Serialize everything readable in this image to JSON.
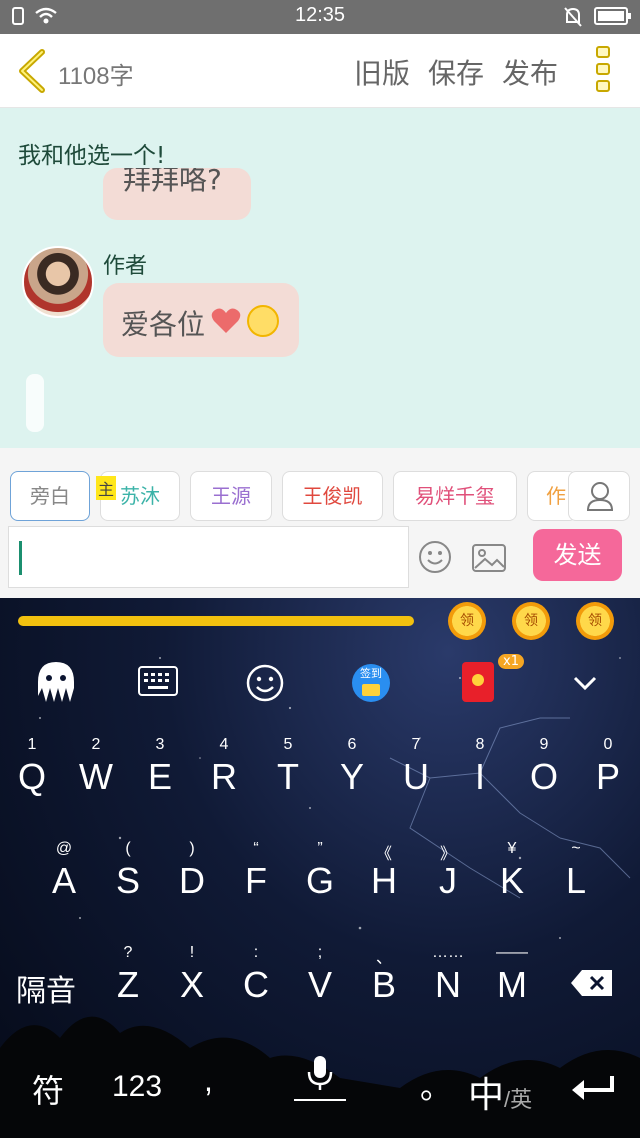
{
  "status": {
    "time": "12:35"
  },
  "header": {
    "word_count": "1108字",
    "old_version": "旧版",
    "save": "保存",
    "publish": "发布"
  },
  "chat": {
    "title": "我和他选一个!",
    "prev_bubble": "拜拜咯?",
    "author_label": "作者",
    "message_text": "爱各位"
  },
  "roles": {
    "items": [
      "旁白",
      "苏沐",
      "王源",
      "王俊凯",
      "易烊千玺",
      "作"
    ],
    "main_badge": "主",
    "colors": [
      "#888888",
      "#3bb3a8",
      "#9a6fd0",
      "#e0483e",
      "#e0507a",
      "#f0a040"
    ]
  },
  "input": {
    "value": "",
    "send_label": "发送"
  },
  "keyboard": {
    "coins": [
      "领",
      "领",
      "领"
    ],
    "signin_label": "签到",
    "redpacket_count": "x1",
    "row1": [
      {
        "n": "1",
        "l": "Q"
      },
      {
        "n": "2",
        "l": "W"
      },
      {
        "n": "3",
        "l": "E"
      },
      {
        "n": "4",
        "l": "R"
      },
      {
        "n": "5",
        "l": "T"
      },
      {
        "n": "6",
        "l": "Y"
      },
      {
        "n": "7",
        "l": "U"
      },
      {
        "n": "8",
        "l": "I"
      },
      {
        "n": "9",
        "l": "O"
      },
      {
        "n": "0",
        "l": "P"
      }
    ],
    "row2": [
      {
        "n": "@",
        "l": "A"
      },
      {
        "n": "(",
        "l": "S"
      },
      {
        "n": ")",
        "l": "D"
      },
      {
        "n": "“",
        "l": "F"
      },
      {
        "n": "”",
        "l": "G"
      },
      {
        "n": "《",
        "l": "H"
      },
      {
        "n": "》",
        "l": "J"
      },
      {
        "n": "¥",
        "l": "K"
      },
      {
        "n": "~",
        "l": "L"
      }
    ],
    "row3": [
      {
        "n": "?",
        "l": "Z"
      },
      {
        "n": "!",
        "l": "X"
      },
      {
        "n": ":",
        "l": "C"
      },
      {
        "n": ";",
        "l": "V"
      },
      {
        "n": "、",
        "l": "B"
      },
      {
        "n": "……",
        "l": "N"
      },
      {
        "n": "——",
        "l": "M"
      }
    ],
    "separator": "隔音",
    "symbols": "符",
    "numbers": "123",
    "comma": ",",
    "period": "。",
    "lang_main": "中",
    "lang_sub": "/英"
  }
}
